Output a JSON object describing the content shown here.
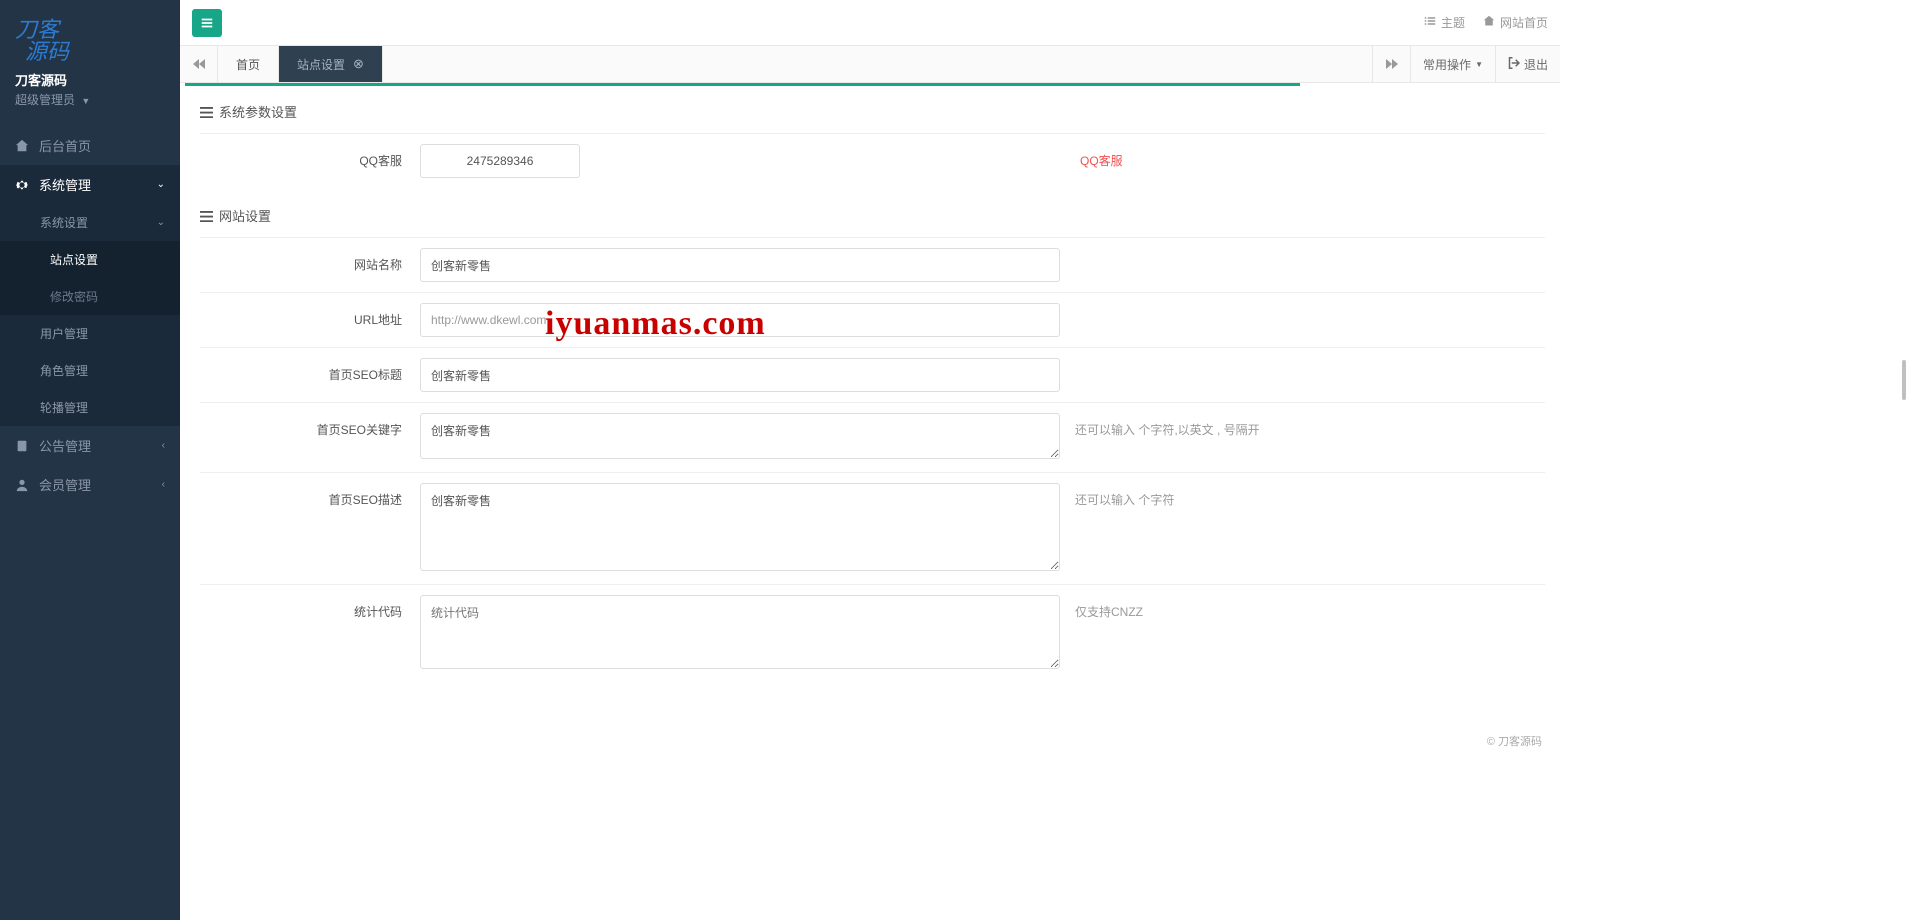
{
  "brand": {
    "name": "刀客源码",
    "role": "超级管理员"
  },
  "sidebar": {
    "items": [
      {
        "label": "后台首页",
        "icon": "home"
      },
      {
        "label": "系统管理",
        "icon": "gear"
      },
      {
        "label": "公告管理",
        "icon": "clipboard"
      },
      {
        "label": "会员管理",
        "icon": "user"
      }
    ],
    "system_sub": [
      {
        "label": "系统设置"
      },
      {
        "label": "用户管理"
      },
      {
        "label": "角色管理"
      },
      {
        "label": "轮播管理"
      }
    ],
    "system_setting_sub": [
      {
        "label": "站点设置"
      },
      {
        "label": "修改密码"
      }
    ]
  },
  "topbar": {
    "theme": "主题",
    "site_home": "网站首页"
  },
  "tabbar": {
    "tabs": [
      {
        "label": "首页"
      },
      {
        "label": "站点设置"
      }
    ],
    "common_ops": "常用操作",
    "logout": "退出"
  },
  "panels": {
    "sys_params_title": "系统参数设置",
    "site_settings_title": "网站设置"
  },
  "form": {
    "qq_label": "QQ客服",
    "qq_value": "2475289346",
    "qq_help": "QQ客服",
    "site_name_label": "网站名称",
    "site_name_value": "创客新零售",
    "url_label": "URL地址",
    "url_value": "http://www.dkewl.com",
    "seo_title_label": "首页SEO标题",
    "seo_title_value": "创客新零售",
    "seo_keywords_label": "首页SEO关键字",
    "seo_keywords_value": "创客新零售",
    "seo_keywords_help": "还可以输入 个字符,以英文 , 号隔开",
    "seo_desc_label": "首页SEO描述",
    "seo_desc_value": "创客新零售",
    "seo_desc_help": "还可以输入 个字符",
    "stats_label": "统计代码",
    "stats_placeholder": "统计代码",
    "stats_help": "仅支持CNZZ"
  },
  "footer": "© 刀客源码",
  "watermark": "iyuanmas.com"
}
